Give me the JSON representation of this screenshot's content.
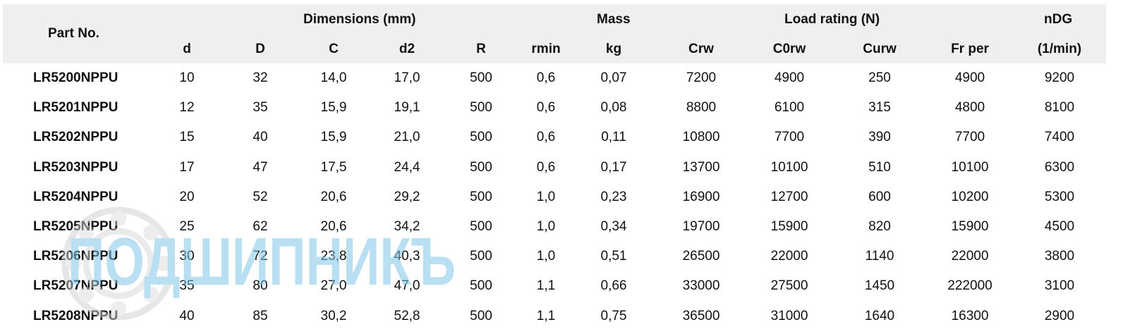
{
  "headers": {
    "part_no": "Part No.",
    "dimensions": "Dimensions (mm)",
    "mass": "Mass",
    "load_rating": "Load rating (N)",
    "ndg": "nDG",
    "cols": [
      "d",
      "D",
      "C",
      "d2",
      "R",
      "rmin",
      "kg",
      "Crw",
      "C0rw",
      "Curw",
      "Fr per",
      "(1/min)"
    ]
  },
  "rows": [
    {
      "part": "LR5200NPPU",
      "vals": [
        "10",
        "32",
        "14,0",
        "17,0",
        "500",
        "0,6",
        "0,07",
        "7200",
        "4900",
        "250",
        "4900",
        "9200"
      ]
    },
    {
      "part": "LR5201NPPU",
      "vals": [
        "12",
        "35",
        "15,9",
        "19,1",
        "500",
        "0,6",
        "0,08",
        "8800",
        "6100",
        "315",
        "4800",
        "8100"
      ]
    },
    {
      "part": "LR5202NPPU",
      "vals": [
        "15",
        "40",
        "15,9",
        "21,0",
        "500",
        "0,6",
        "0,11",
        "10800",
        "7700",
        "390",
        "7700",
        "7400"
      ]
    },
    {
      "part": "LR5203NPPU",
      "vals": [
        "17",
        "47",
        "17,5",
        "24,4",
        "500",
        "0,6",
        "0,17",
        "13700",
        "10100",
        "510",
        "10100",
        "6300"
      ]
    },
    {
      "part": "LR5204NPPU",
      "vals": [
        "20",
        "52",
        "20,6",
        "29,2",
        "500",
        "1,0",
        "0,23",
        "16900",
        "12700",
        "600",
        "10200",
        "5300"
      ]
    },
    {
      "part": "LR5205NPPU",
      "vals": [
        "25",
        "62",
        "20,6",
        "34,2",
        "500",
        "1,0",
        "0,34",
        "19700",
        "15900",
        "820",
        "15900",
        "4500"
      ]
    },
    {
      "part": "LR5206NPPU",
      "vals": [
        "30",
        "72",
        "23,8",
        "40,3",
        "500",
        "1,0",
        "0,51",
        "26500",
        "22000",
        "1140",
        "22000",
        "3800"
      ]
    },
    {
      "part": "LR5207NPPU",
      "vals": [
        "35",
        "80",
        "27,0",
        "47,0",
        "500",
        "1,1",
        "0,66",
        "33000",
        "27500",
        "1450",
        "222000",
        "3100"
      ]
    },
    {
      "part": "LR5208NPPU",
      "vals": [
        "40",
        "85",
        "30,2",
        "52,8",
        "500",
        "1,1",
        "0,75",
        "36500",
        "31000",
        "1640",
        "16300",
        "2900"
      ]
    }
  ],
  "watermark": {
    "text": "ПОДШИПНИКЪ",
    "color": "#7fc6e8"
  }
}
